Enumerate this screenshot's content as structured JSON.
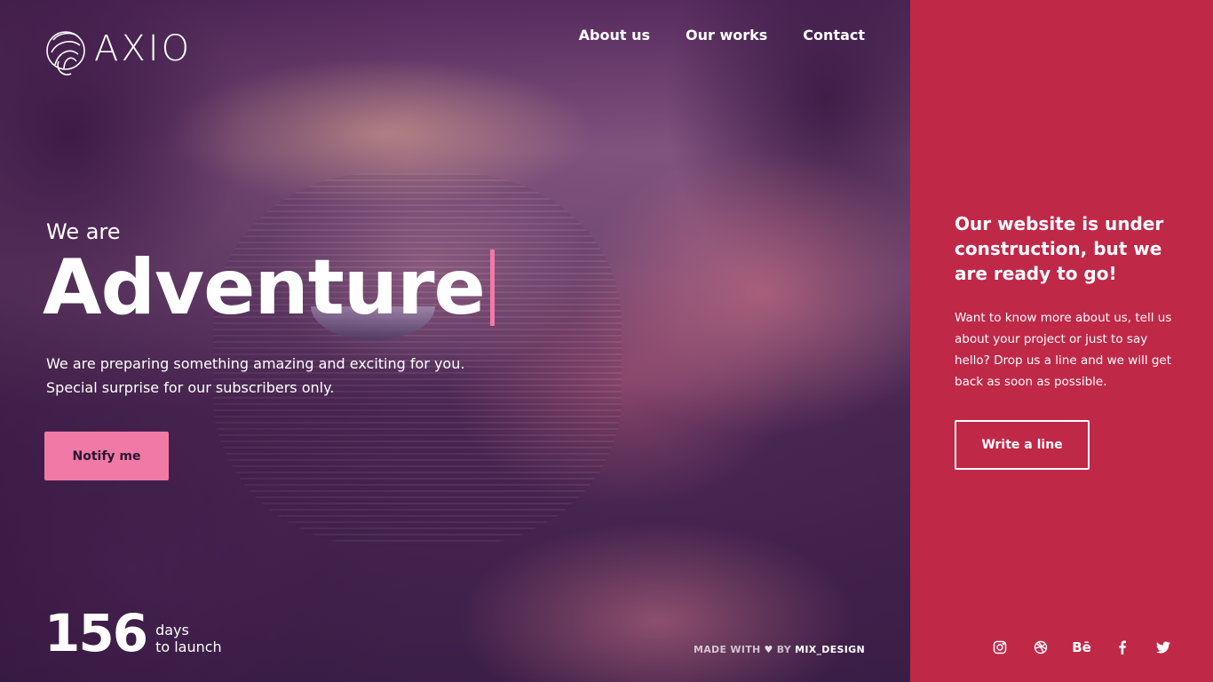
{
  "brand": {
    "name": "AXIO"
  },
  "nav": {
    "items": [
      {
        "label": "About us"
      },
      {
        "label": "Our works"
      },
      {
        "label": "Contact"
      }
    ]
  },
  "hero": {
    "intro": "We are",
    "headline": "Adventure",
    "tagline": "We are preparing something amazing and exciting for you. Special surprise for our subscribers only.",
    "notify_label": "Notify me"
  },
  "countdown": {
    "number": "156",
    "label_line1": "days",
    "label_line2": "to launch"
  },
  "credit": {
    "made_with": "MADE WITH",
    "by": "BY",
    "brand": "MIX_DESIGN"
  },
  "panel": {
    "title": "Our website is under construction, but we are ready to go!",
    "text": "Want to know more about us, tell us about your project or just to say hello? Drop us a line and we will get back as soon as possible.",
    "button_label": "Write a line",
    "accent_color": "#c02848"
  },
  "socials": {
    "behance_label": "Bē"
  },
  "colors": {
    "cta_pink": "#f07aa5",
    "panel_red": "#c02848"
  }
}
